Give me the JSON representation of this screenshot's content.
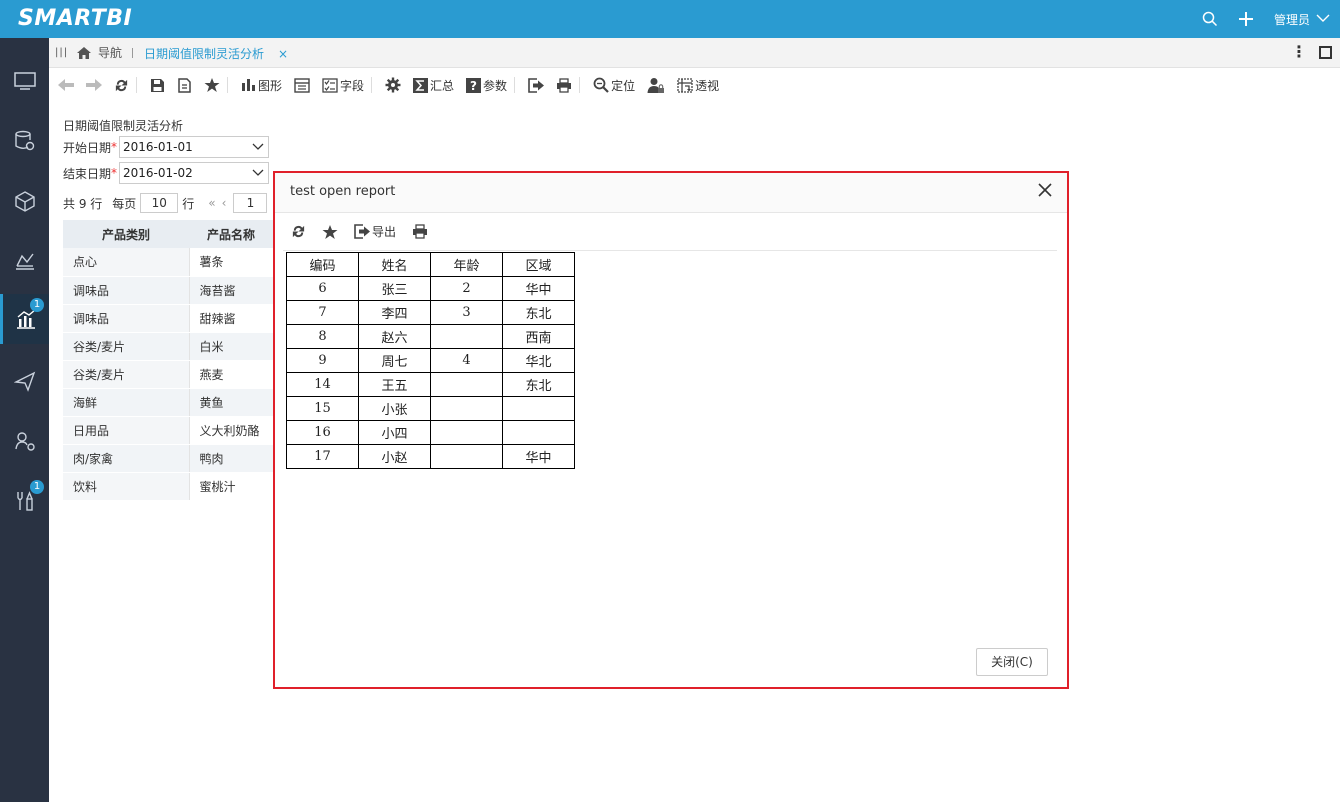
{
  "app": {
    "logo": "SMARTBI",
    "user": "管理员",
    "accent": "#2a9bd1"
  },
  "nav": {
    "items": [
      {
        "name": "desktop",
        "icon": "monitor-icon"
      },
      {
        "name": "data",
        "icon": "database-gear-icon"
      },
      {
        "name": "model",
        "icon": "cube-icon"
      },
      {
        "name": "mining",
        "icon": "analysis-icon"
      },
      {
        "name": "analysis",
        "icon": "bar-chart-icon",
        "badge": "1"
      },
      {
        "name": "publish",
        "icon": "send-icon"
      },
      {
        "name": "users",
        "icon": "user-tree-icon"
      },
      {
        "name": "tools",
        "icon": "tools-icon",
        "badge": "1"
      }
    ]
  },
  "tabs": {
    "home_label": "导航",
    "active_label": "日期阈值限制灵活分析",
    "close": "×"
  },
  "toolbar": {
    "chart": "图形",
    "field": "字段",
    "summary": "汇总",
    "param": "参数",
    "locate": "定位",
    "pivot": "透视"
  },
  "report": {
    "title": "日期阈值限制灵活分析",
    "start_label": "开始日期",
    "start_value": "2016-01-01",
    "end_label": "结束日期",
    "end_value": "2016-01-02",
    "required_mark": "*",
    "pager_total": "共 9 行",
    "pager_per": "每页",
    "pager_size": "10",
    "pager_unit": "行",
    "pager_page": "1",
    "columns": [
      "产品类别",
      "产品名称"
    ],
    "rows": [
      [
        "点心",
        "薯条"
      ],
      [
        "调味品",
        "海苔酱"
      ],
      [
        "调味品",
        "甜辣酱"
      ],
      [
        "谷类/麦片",
        "白米"
      ],
      [
        "谷类/麦片",
        "燕麦"
      ],
      [
        "海鲜",
        "黄鱼"
      ],
      [
        "日用品",
        "义大利奶酪"
      ],
      [
        "肉/家禽",
        "鸭肉"
      ],
      [
        "饮料",
        "蜜桃汁"
      ]
    ]
  },
  "dialog": {
    "title": "test open report",
    "export_label": "导出",
    "close_button": "关闭(C)",
    "columns": [
      "编码",
      "姓名",
      "年龄",
      "区域"
    ],
    "rows": [
      [
        "6",
        "张三",
        "2",
        "华中"
      ],
      [
        "7",
        "李四",
        "3",
        "东北"
      ],
      [
        "8",
        "赵六",
        "",
        "西南"
      ],
      [
        "9",
        "周七",
        "4",
        "华北"
      ],
      [
        "14",
        "王五",
        "",
        "东北"
      ],
      [
        "15",
        "小张",
        "",
        ""
      ],
      [
        "16",
        "小四",
        "",
        ""
      ],
      [
        "17",
        "小赵",
        "",
        "华中"
      ]
    ]
  }
}
